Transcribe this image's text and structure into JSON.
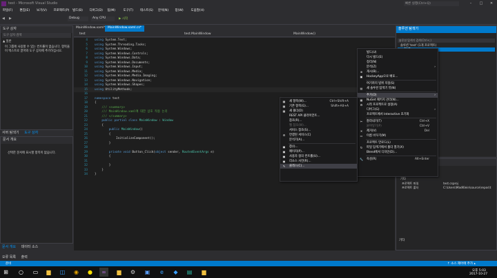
{
  "window": {
    "title": "test - Microsoft Visual Studio",
    "quick_launch": "빠른 실행(Ctrl+Q)"
  },
  "menu_items": [
    "파일(F)",
    "편집(E)",
    "보기(V)",
    "프로젝트(P)",
    "빌드(B)",
    "디버그(D)",
    "팀(M)",
    "도구(T)",
    "테스트(S)",
    "분석(N)",
    "창(W)",
    "도움말(H)"
  ],
  "toolbar": {
    "config": "Debug",
    "platform": "Any CPU",
    "start": "▶ 시작"
  },
  "toolbox": {
    "title": "도구 상자",
    "search": "도구 상자 검색",
    "group": "▲ 일반",
    "empty_text": "이 그룹에 사용할 수 있는 컨트롤이 없습니다. 항목을 이 텍스트로 끌어와 도구 상자에 추가하십시오.",
    "tabs": [
      "서버 탐색기",
      "도구 상자"
    ]
  },
  "outline": {
    "title": "문서 개요",
    "empty_text": "선택한 문서에 표시할 항목이 없습니다.",
    "tabs": [
      "문서 개요",
      "데이터 소스"
    ]
  },
  "editor_tabs": [
    {
      "label": "MainWindow.xaml*"
    },
    {
      "label": "MainWindow.xaml.cs*"
    }
  ],
  "nav": {
    "left": "test",
    "middle": "test.MainWindow",
    "right": "MainWindow()"
  },
  "code_lines": [
    "using System.Text;",
    "using System.Threading.Tasks;",
    "using System.Windows;",
    "using System.Windows.Controls;",
    "using System.Windows.Data;",
    "using System.Windows.Documents;",
    "using System.Windows.Input;",
    "using System.Windows.Media;",
    "using System.Windows.Media.Imaging;",
    "using System.Windows.Navigation;",
    "using System.Windows.Shapes;",
    "using UtilityMethods;",
    "",
    "namespace test",
    "{",
    "    /// <summary>",
    "    /// MainWindow.xaml에 대한 상호 작용 논리",
    "    /// </summary>",
    "    public partial class MainWindow : Window",
    "    {",
    "        public MainWindow()",
    "        {",
    "            InitializeComponent();",
    "        }",
    "",
    "        private void Button_Click(object sender, RoutedEventArgs e)",
    "        {",
    "",
    "        }",
    "    }",
    "}"
  ],
  "line_numbers": [
    "4",
    "5",
    "6",
    "7",
    "8",
    "9",
    "10",
    "11",
    "12",
    "13",
    "14",
    "15",
    "16",
    "17",
    "18",
    "19",
    "20",
    "21",
    "22",
    "23",
    "24",
    "25",
    "26",
    "27",
    "28",
    "29",
    "30",
    "31",
    "32",
    "33",
    "34"
  ],
  "project_menu": [
    {
      "icon": "",
      "label": "빌드(U)",
      "shortcut": ""
    },
    {
      "icon": "",
      "label": "다시 빌드(E)",
      "shortcut": ""
    },
    {
      "icon": "",
      "label": "정리(N)",
      "shortcut": ""
    },
    {
      "icon": "",
      "label": "분석(Z)",
      "shortcut": "",
      "arrow": "›"
    },
    {
      "icon": "⊕",
      "label": "게시(B)...",
      "shortcut": ""
    },
    {
      "icon": "▣",
      "label": "HockeyApp으로 배포...",
      "shortcut": ""
    },
    {
      "sep": true
    },
    {
      "icon": "",
      "label": "여기까지 범위 지정(S)",
      "shortcut": ""
    },
    {
      "icon": "▤",
      "label": "새 솔루션 탐색기 뷰(N)",
      "shortcut": ""
    },
    {
      "sep": true
    },
    {
      "icon": "",
      "label": "추가(D)",
      "shortcut": "",
      "arrow": "›",
      "hl": true
    },
    {
      "icon": "▦",
      "label": "NuGet 패키지 관리(N)...",
      "shortcut": ""
    },
    {
      "icon": "⚙",
      "label": "시작 프로젝트로 설정(A)",
      "shortcut": ""
    },
    {
      "icon": "",
      "label": "디버그(G)",
      "shortcut": "",
      "arrow": "›"
    },
    {
      "icon": "",
      "label": "프로젝트에서 Interactive 초기화",
      "shortcut": ""
    },
    {
      "sep": true
    },
    {
      "icon": "✂",
      "label": "잘라내기(T)",
      "shortcut": "Ctrl+X"
    },
    {
      "icon": "",
      "label": "붙여넣기(P)",
      "shortcut": "Ctrl+V",
      "dis": true
    },
    {
      "icon": "✕",
      "label": "제거(V)",
      "shortcut": "Del"
    },
    {
      "icon": "▭",
      "label": "이름 바꾸기(M)",
      "shortcut": ""
    },
    {
      "sep": true
    },
    {
      "icon": "",
      "label": "프로젝트 언로드(L)",
      "shortcut": ""
    },
    {
      "icon": "↻",
      "label": "파일 탐색기에서 폴더 열기(X)",
      "shortcut": ""
    },
    {
      "icon": "",
      "label": "Blend에서 디자인(D)...",
      "shortcut": ""
    },
    {
      "sep": true
    },
    {
      "icon": "🔧",
      "label": "속성(R)",
      "shortcut": "Alt+Enter"
    }
  ],
  "add_menu": [
    {
      "icon": "▦",
      "label": "새 항목(W)...",
      "shortcut": "Ctrl+Shift+A"
    },
    {
      "icon": "▦",
      "label": "기존 항목(G)...",
      "shortcut": "Shift+Alt+A"
    },
    {
      "icon": "▦",
      "label": "새 폴더(D)",
      "shortcut": ""
    },
    {
      "icon": "",
      "label": "REST API 클라이언트...",
      "shortcut": ""
    },
    {
      "icon": "",
      "label": "참조(R)...",
      "shortcut": ""
    },
    {
      "icon": "",
      "label": "웹 참조(W)...",
      "shortcut": "",
      "dis": true
    },
    {
      "icon": "",
      "label": "서비스 참조(S)...",
      "shortcut": ""
    },
    {
      "icon": "⚙",
      "label": "연결된 서비스(C)",
      "shortcut": ""
    },
    {
      "icon": "",
      "label": "분석기(A)...",
      "shortcut": ""
    },
    {
      "sep": true
    },
    {
      "icon": "▣",
      "label": "창(I)...",
      "shortcut": ""
    },
    {
      "icon": "▣",
      "label": "페이지(P)...",
      "shortcut": ""
    },
    {
      "icon": "▣",
      "label": "사용자 정의 컨트롤(U)...",
      "shortcut": ""
    },
    {
      "icon": "▣",
      "label": "리소스 사전(R)...",
      "shortcut": ""
    },
    {
      "icon": "✎",
      "label": "클래스(C)...",
      "shortcut": "",
      "hl": true
    }
  ],
  "solution": {
    "title": "솔루션 탐색기",
    "search": "솔루션 탐색기 검색(Ctrl+;)",
    "root": "솔루션 'test' (1개 프로젝트)",
    "project": "test"
  },
  "properties": {
    "title": "속성",
    "section": "기타",
    "rows": [
      {
        "name": "프로젝트 파일",
        "value": "test.csproj"
      },
      {
        "name": "프로젝트 폴더",
        "value": "C:\\Users\\MadKlein\\source\\repos\\t"
      }
    ],
    "footer": "기타"
  },
  "bottom": {
    "tabs": [
      "오류 목록",
      "출력"
    ]
  },
  "status": {
    "left": "준비",
    "right": "↑ 소스 제어에 추가 ▴"
  },
  "clock": {
    "time": "오후 5:03",
    "date": "2017-10-27"
  }
}
